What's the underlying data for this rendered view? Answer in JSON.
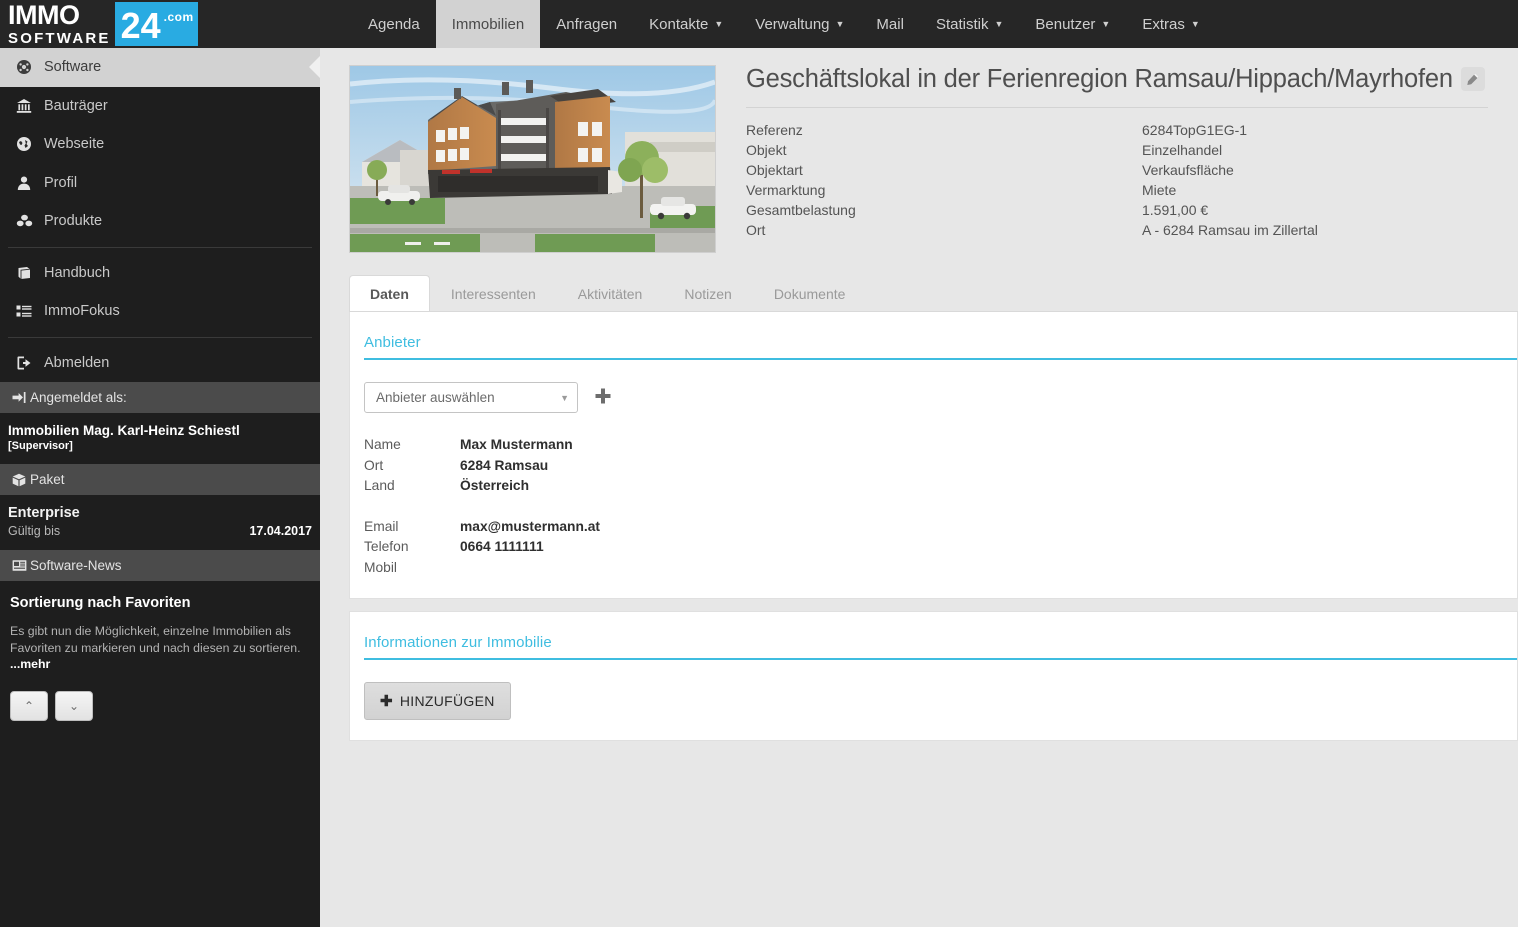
{
  "brand": {
    "immo": "IMMO",
    "software": "SOFTWARE",
    "num": "24",
    "com": ".com"
  },
  "topnav": {
    "items": [
      {
        "label": "Agenda",
        "caret": false,
        "active": false
      },
      {
        "label": "Immobilien",
        "caret": false,
        "active": true
      },
      {
        "label": "Anfragen",
        "caret": false,
        "active": false
      },
      {
        "label": "Kontakte",
        "caret": true,
        "active": false
      },
      {
        "label": "Verwaltung",
        "caret": true,
        "active": false
      },
      {
        "label": "Mail",
        "caret": false,
        "active": false
      },
      {
        "label": "Statistik",
        "caret": true,
        "active": false
      },
      {
        "label": "Benutzer",
        "caret": true,
        "active": false
      },
      {
        "label": "Extras",
        "caret": true,
        "active": false
      }
    ],
    "caret_glyph": "▼"
  },
  "sidebar": {
    "items": [
      {
        "label": "Software",
        "icon": "dashboard-icon",
        "glyph": "◉",
        "active": true
      },
      {
        "label": "Bauträger",
        "icon": "bank-icon",
        "glyph": "🏛",
        "active": false
      },
      {
        "label": "Webseite",
        "icon": "globe-icon",
        "glyph": "🌐",
        "active": false
      },
      {
        "label": "Profil",
        "icon": "user-icon",
        "glyph": "👤",
        "active": false
      },
      {
        "label": "Produkte",
        "icon": "cubes-icon",
        "glyph": "❖",
        "active": false
      },
      {
        "label": "Handbuch",
        "icon": "book-icon",
        "glyph": "📕",
        "active": false
      },
      {
        "label": "ImmoFokus",
        "icon": "list-icon",
        "glyph": "▤",
        "active": false
      },
      {
        "label": "Abmelden",
        "icon": "logout-icon",
        "glyph": "↪",
        "active": false
      }
    ],
    "logged_in_header": "Angemeldet als:",
    "logged_in_icon": "sign-in-icon",
    "user_name": "Immobilien Mag. Karl-Heinz Schiestl",
    "user_role": "[Supervisor]",
    "paket_header": "Paket",
    "paket_icon": "box-icon",
    "paket_name": "Enterprise",
    "paket_valid_label": "Gültig bis",
    "paket_valid_value": "17.04.2017",
    "news_header": "Software-News",
    "news_icon": "newspaper-icon",
    "news_title": "Sortierung nach Favoriten",
    "news_text": "Es gibt nun die Möglichkeit, einzelne Immobilien als Favoriten zu markieren und nach diesen zu sortieren. ",
    "news_more": "...mehr",
    "news_prev_glyph": "⌃",
    "news_next_glyph": "⌄"
  },
  "property": {
    "title": "Geschäftslokal in der Ferienregion Ramsau/Hippach/Mayrhofen",
    "edit_icon": "pencil-icon",
    "image_alt": "3D-Rendering eines modernen Wohn- und Geschäftsgebäudes",
    "fields": [
      {
        "label": "Referenz",
        "value": "6284TopG1EG-1"
      },
      {
        "label": "Objekt",
        "value": "Einzelhandel"
      },
      {
        "label": "Objektart",
        "value": "Verkaufsfläche"
      },
      {
        "label": "Vermarktung",
        "value": "Miete"
      },
      {
        "label": "Gesamtbelastung",
        "value": "1.591,00 €"
      },
      {
        "label": "Ort",
        "value": "A - 6284 Ramsau im Zillertal"
      }
    ]
  },
  "tabs": [
    {
      "label": "Daten",
      "active": true
    },
    {
      "label": "Interessenten",
      "active": false
    },
    {
      "label": "Aktivitäten",
      "active": false
    },
    {
      "label": "Notizen",
      "active": false
    },
    {
      "label": "Dokumente",
      "active": false
    }
  ],
  "anbieter": {
    "section_title": "Anbieter",
    "select_value": "Anbieter auswählen",
    "select_caret": "▼",
    "add_icon": "plus-icon",
    "rows_primary": [
      {
        "label": "Name",
        "value": "Max Mustermann"
      },
      {
        "label": "Ort",
        "value": "6284 Ramsau"
      },
      {
        "label": "Land",
        "value": "Österreich"
      }
    ],
    "rows_secondary": [
      {
        "label": "Email",
        "value": "max@mustermann.at"
      },
      {
        "label": "Telefon",
        "value": "0664 1111111"
      },
      {
        "label": "Mobil",
        "value": ""
      }
    ]
  },
  "immobilie": {
    "section_title": "Informationen zur Immobilie",
    "add_button_label": "HINZUFÜGEN",
    "add_button_icon": "plus-icon",
    "add_button_glyph": "✚"
  },
  "colors": {
    "accent_cyan": "#3fbde0",
    "brand_blue": "#29abe2",
    "sidebar_bg": "#1e1e1e",
    "topbar_bg": "#262626",
    "page_bg": "#e7e7e7",
    "active_tab_bg": "#d2d2d2"
  }
}
